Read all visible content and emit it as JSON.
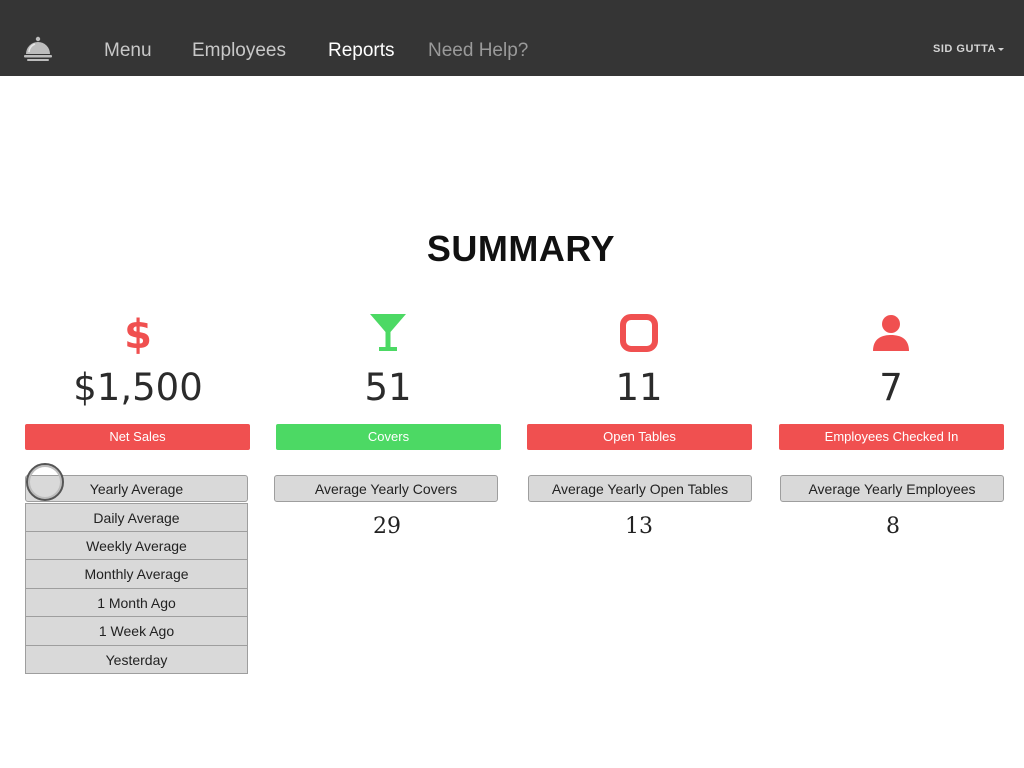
{
  "nav": {
    "logo_icon": "cloche-icon",
    "links": [
      {
        "label": "Menu"
      },
      {
        "label": "Employees"
      },
      {
        "label": "Reports",
        "active": true
      },
      {
        "label": "Need Help?"
      }
    ],
    "user": "SID GUTTA"
  },
  "page": {
    "title": "SUMMARY"
  },
  "colors": {
    "navbar": "#353535",
    "red": "#f05050",
    "green": "#4cd964",
    "dropdown_bg": "#d9d9d9"
  },
  "metrics": [
    {
      "icon": "dollar-icon",
      "value": "$1,500",
      "label": "Net Sales",
      "label_color": "#f05050",
      "comparison_label": "Yearly Average",
      "comparison_value": ""
    },
    {
      "icon": "cocktail-icon",
      "value": "51",
      "label": "Covers",
      "label_color": "#4cd964",
      "comparison_label": "Average Yearly Covers",
      "comparison_value": "29"
    },
    {
      "icon": "table-icon",
      "value": "11",
      "label": "Open Tables",
      "label_color": "#f05050",
      "comparison_label": "Average Yearly Open Tables",
      "comparison_value": "13"
    },
    {
      "icon": "user-icon",
      "value": "7",
      "label": "Employees Checked In",
      "label_color": "#f05050",
      "comparison_label": "Average Yearly Employees",
      "comparison_value": "8"
    }
  ],
  "net_sales_options": [
    "Daily Average",
    "Weekly Average",
    "Monthly Average",
    "1 Month Ago",
    "1 Week Ago",
    "Yesterday"
  ]
}
